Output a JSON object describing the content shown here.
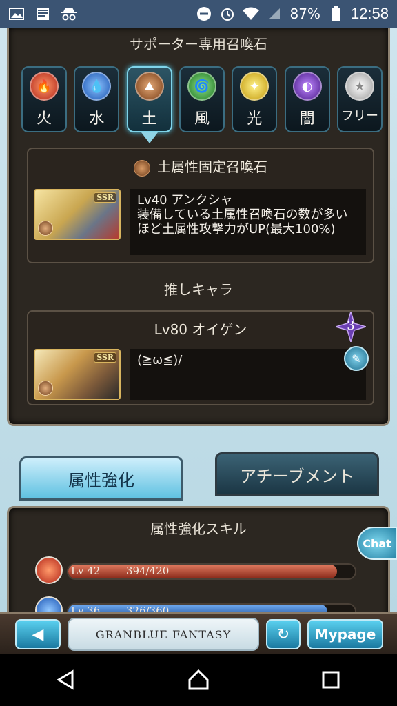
{
  "status_bar": {
    "battery": "87%",
    "time": "12:58"
  },
  "supporter": {
    "header": "サポーター専用召喚石",
    "elements": [
      {
        "label": "火",
        "icon": "fire-icon",
        "color": "#d9482e"
      },
      {
        "label": "水",
        "icon": "water-icon",
        "color": "#2e7fd9"
      },
      {
        "label": "土",
        "icon": "earth-icon",
        "color": "#b06a3a"
      },
      {
        "label": "風",
        "icon": "wind-icon",
        "color": "#3aa43a"
      },
      {
        "label": "光",
        "icon": "light-icon",
        "color": "#e0c020"
      },
      {
        "label": "闇",
        "icon": "dark-icon",
        "color": "#7a3acb"
      },
      {
        "label": "フリー",
        "icon": "star-icon",
        "color": "#d8d8d8"
      }
    ],
    "summon_box": {
      "title": "土属性固定召喚石",
      "description": "Lv40 アンクシャ\n装備している土属性召喚石の数が多いほど土属性攻撃力がUP(最大100%)",
      "ssr": "SSR"
    }
  },
  "favorite": {
    "header": "推しキャラ",
    "char_line": "Lv80 オイゲン",
    "rank": "3",
    "comment": "(≧ω≦)/",
    "ssr": "SSR"
  },
  "tabs": {
    "active": "属性強化",
    "inactive": "アチーブメント"
  },
  "elemental": {
    "header": "属性強化スキル",
    "skills": [
      {
        "lv": "Lv 42",
        "value": "394/420",
        "progress": 0.938,
        "color": "#c4462e",
        "icon": "fire-icon"
      },
      {
        "lv": "Lv 36",
        "value": "326/360",
        "progress": 0.905,
        "color": "#2e6fc4",
        "icon": "water-icon"
      }
    ]
  },
  "chat_label": "Chat",
  "nav": {
    "logo": "GRANBLUE FANTASY",
    "mypage": "Mypage"
  }
}
